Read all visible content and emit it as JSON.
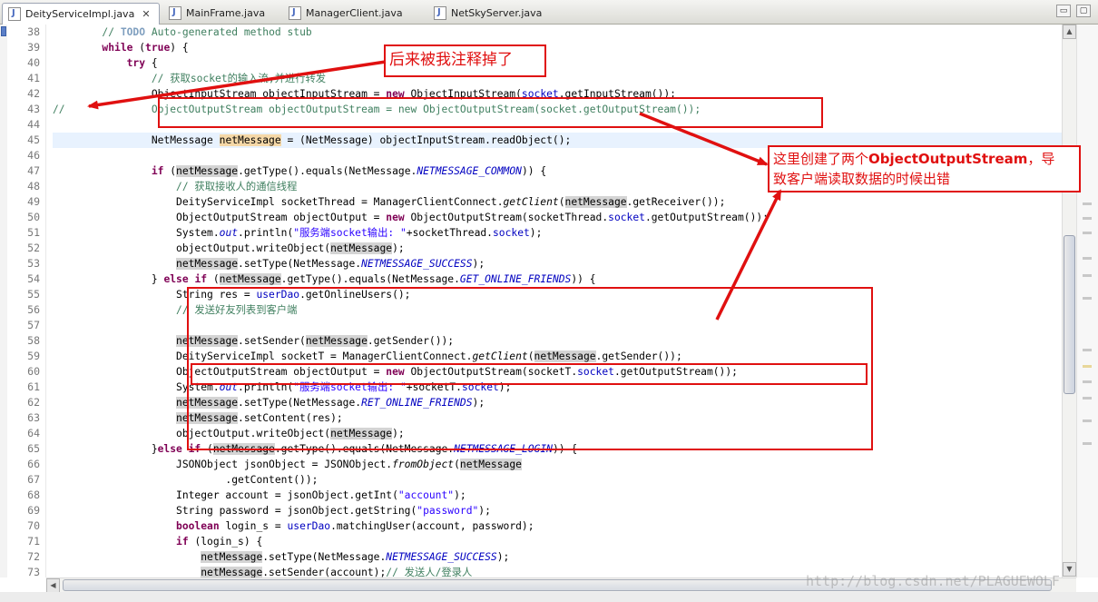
{
  "tabs": [
    {
      "label": "DeityServiceImpl.java",
      "close": "✕",
      "active": true
    },
    {
      "label": "MainFrame.java",
      "active": false
    },
    {
      "label": "ManagerClient.java",
      "active": false
    },
    {
      "label": "NetSkyServer.java",
      "active": false
    }
  ],
  "window_controls": {
    "minimize": "▭",
    "maximize": "▢"
  },
  "line_numbers": [
    "38",
    "39",
    "40",
    "41",
    "42",
    "43",
    "44",
    "45",
    "46",
    "47",
    "48",
    "49",
    "50",
    "51",
    "52",
    "53",
    "54",
    "55",
    "56",
    "57",
    "58",
    "59",
    "60",
    "61",
    "62",
    "63",
    "64",
    "65",
    "66",
    "67",
    "68",
    "69",
    "70",
    "71",
    "72",
    "73"
  ],
  "annotations": {
    "label1": "后来被我注释掉了",
    "label2_line1_a": "这里创建了两个",
    "label2_line1_b": "ObjectOutputStream",
    "label2_line1_c": "，导",
    "label2_line2": "致客户端读取数据的时候出错",
    "color": "#e01010"
  },
  "watermark": "http://blog.csdn.net/PLAGUEWOLF",
  "colors": {
    "keyword": "#7f0055",
    "comment": "#3f7f5f",
    "string": "#2a00ff",
    "field": "#0000c0",
    "highlight": "#d4d4d4"
  }
}
